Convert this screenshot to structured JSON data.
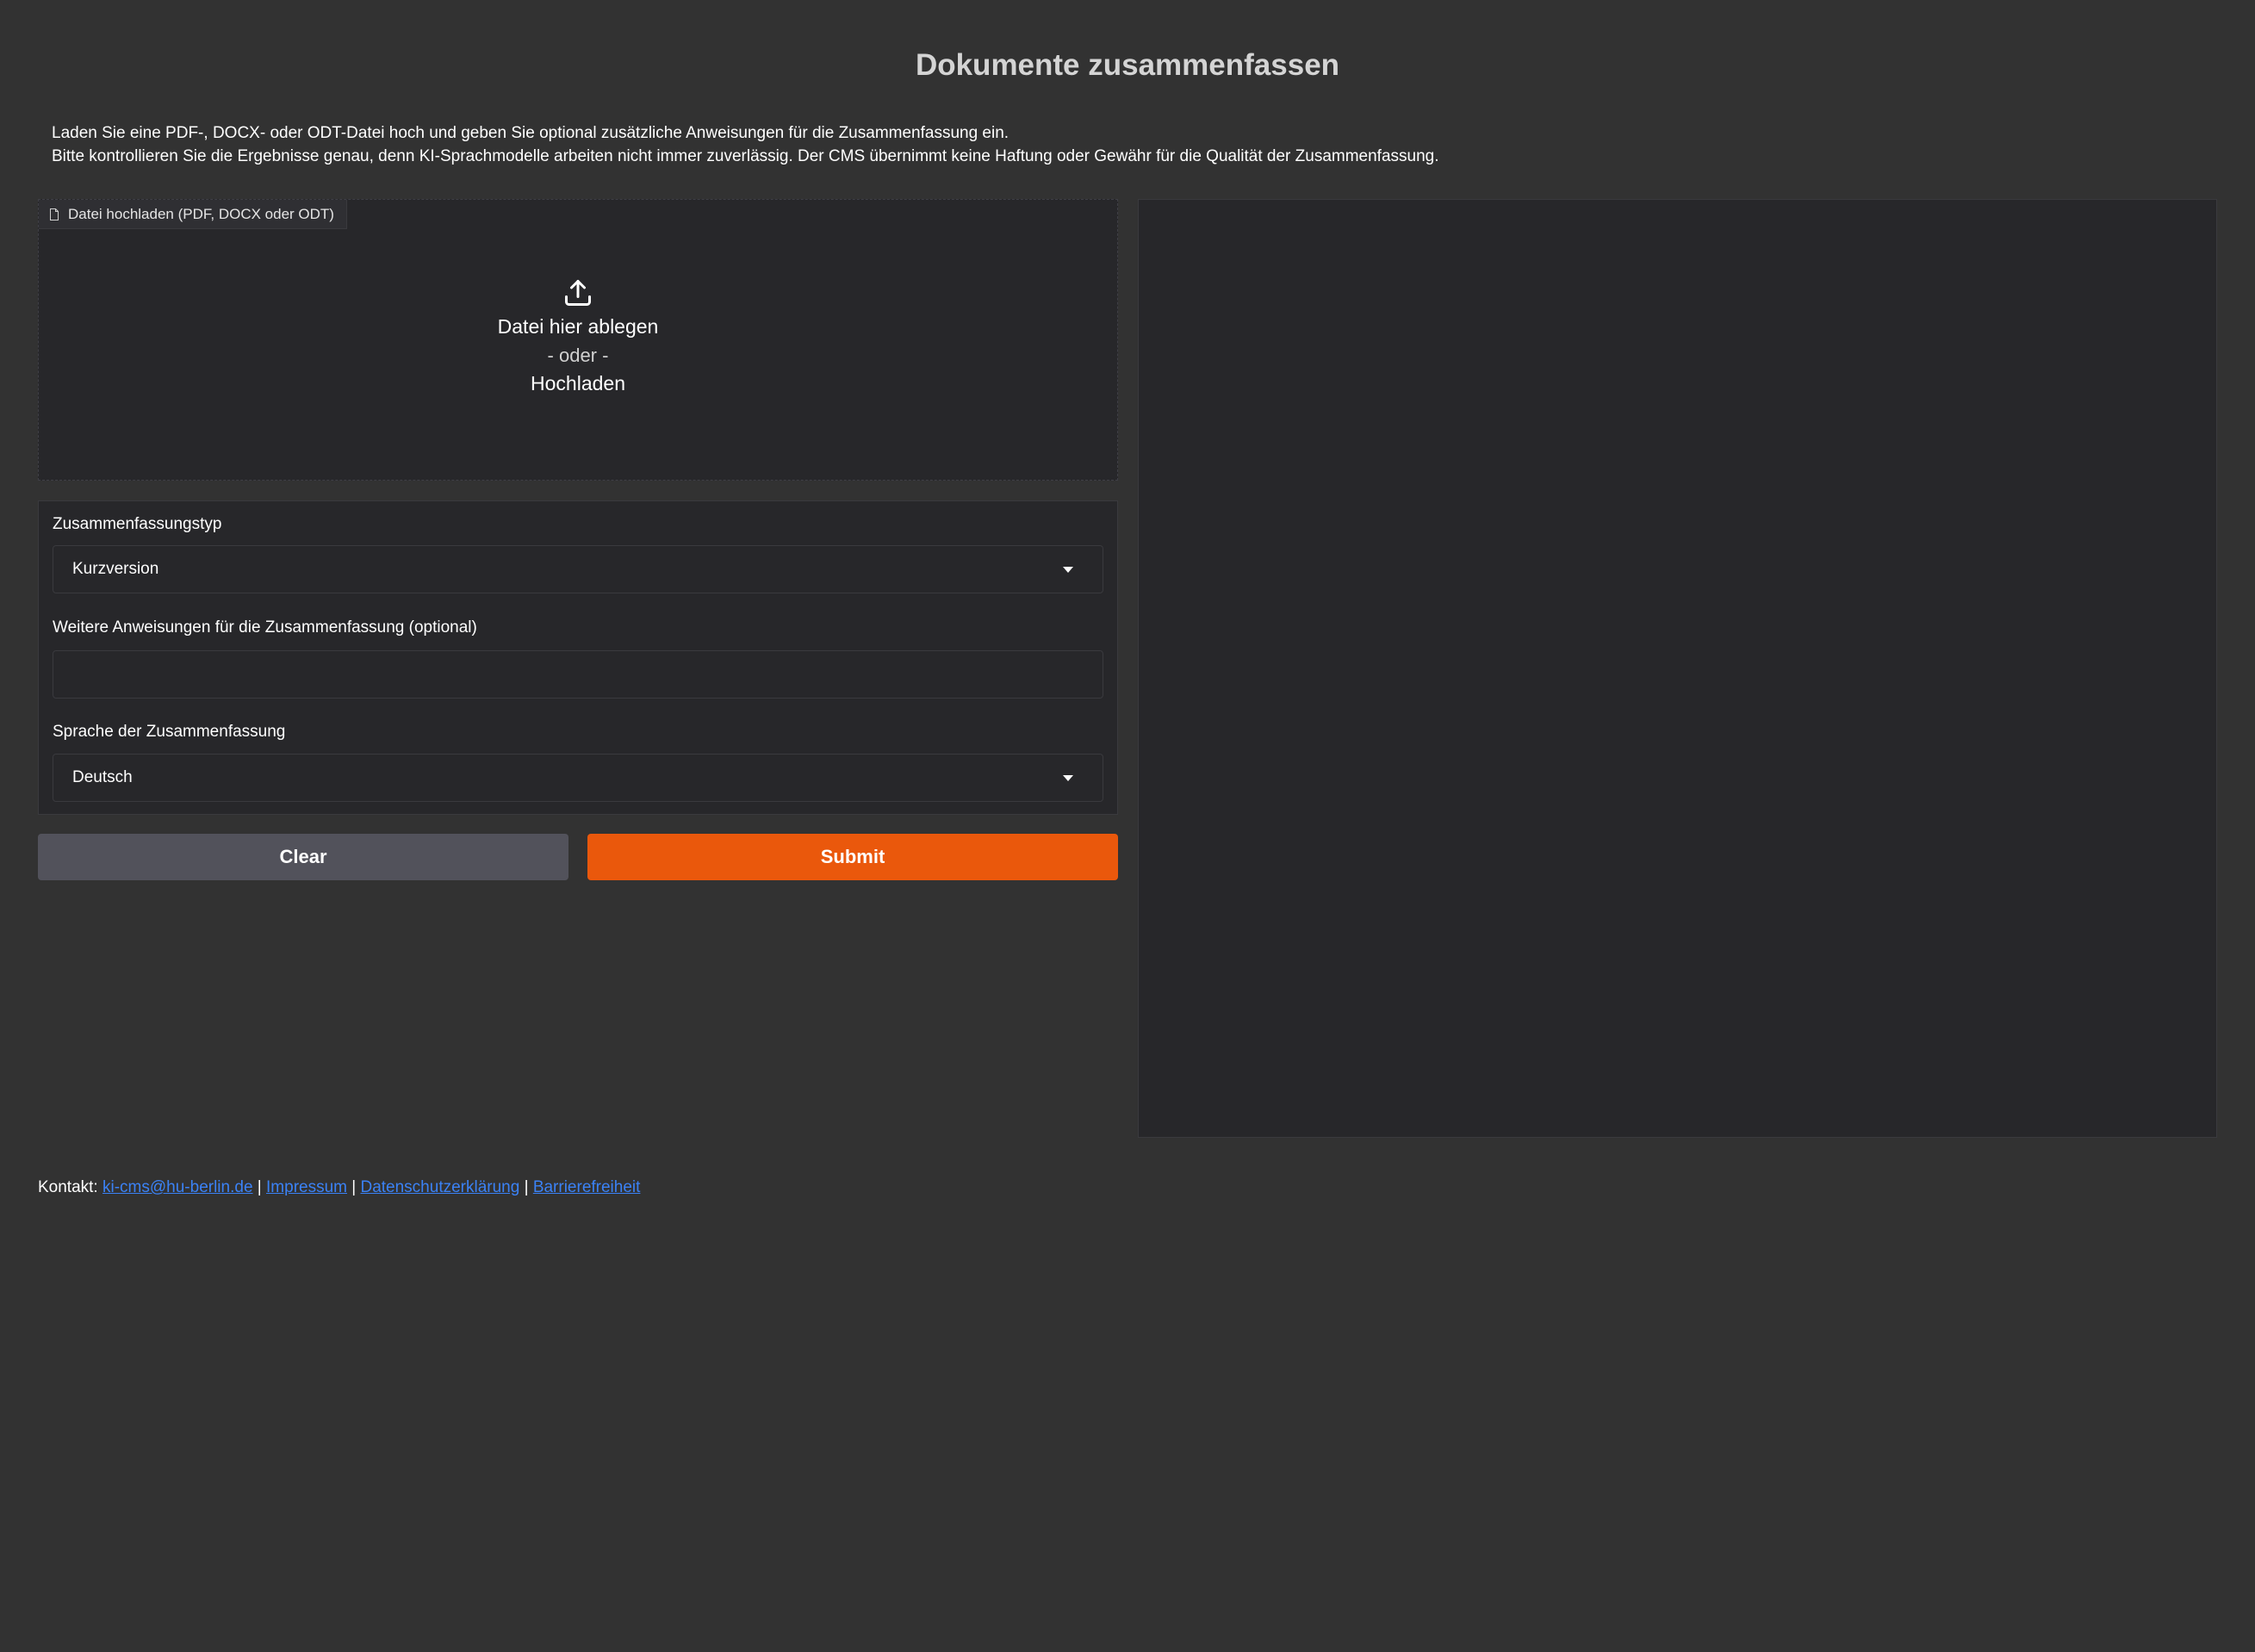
{
  "header": {
    "title": "Dokumente zusammenfassen",
    "description_line1": "Laden Sie eine PDF-, DOCX- oder ODT-Datei hoch und geben Sie optional zusätzliche Anweisungen für die Zusammenfassung ein.",
    "description_line2": "Bitte kontrollieren Sie die Ergebnisse genau, denn KI-Sprachmodelle arbeiten nicht immer zuverlässig. Der CMS übernimmt keine Haftung oder Gewähr für die Qualität der Zusammenfassung."
  },
  "upload": {
    "label": "Datei hochladen (PDF, DOCX oder ODT)",
    "drop_text": "Datei hier ablegen",
    "or_text": "- oder -",
    "upload_text": "Hochladen",
    "icons": {
      "label_icon": "file-icon",
      "drop_icon": "upload-icon"
    }
  },
  "options": {
    "summary_type": {
      "label": "Zusammenfassungstyp",
      "selected": "Kurzversion"
    },
    "instructions": {
      "label": "Weitere Anweisungen für die Zusammenfassung (optional)",
      "value": "",
      "placeholder": ""
    },
    "language": {
      "label": "Sprache der Zusammenfassung",
      "selected": "Deutsch"
    }
  },
  "buttons": {
    "clear": "Clear",
    "submit": "Submit"
  },
  "footer": {
    "prefix": "Kontakt: ",
    "email": "ki-cms@hu-berlin.de",
    "separator": " | ",
    "impressum": "Impressum",
    "datenschutz": "Datenschutzerklärung",
    "barrierefreiheit": "Barrierefreiheit"
  },
  "colors": {
    "background": "#323232",
    "panel": "#27272a",
    "accent": "#ea580c",
    "secondary_button": "#52525b",
    "link": "#3b82f6"
  }
}
